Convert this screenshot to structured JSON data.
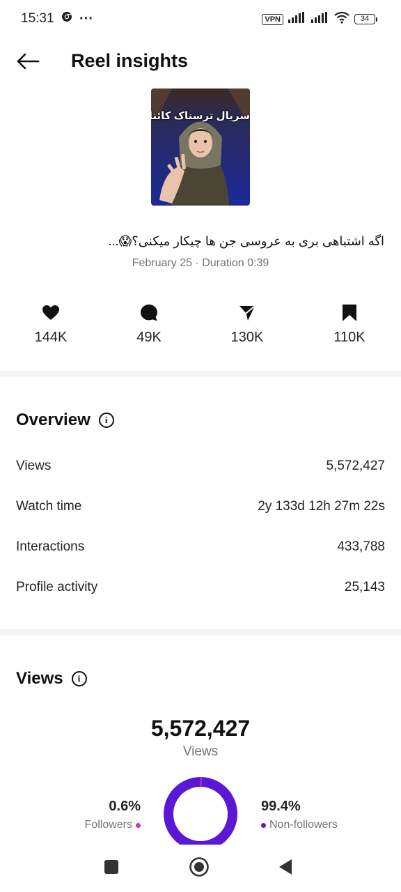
{
  "status_bar": {
    "time": "15:31",
    "more": "···",
    "vpn": "VPN",
    "battery": "34"
  },
  "header": {
    "title": "Reel insights"
  },
  "reel": {
    "thumbnail_text": "سریال ترسناک کائنات",
    "caption": "اگه اشتباهی بری به عروسی جن ها چیکار میکنی؟😱...",
    "meta": "February 25 · Duration 0:39"
  },
  "stats": {
    "likes": "144K",
    "comments": "49K",
    "shares": "130K",
    "saves": "110K"
  },
  "overview": {
    "title": "Overview",
    "rows": [
      {
        "label": "Views",
        "value": "5,572,427"
      },
      {
        "label": "Watch time",
        "value": "2y 133d 12h 27m 22s"
      },
      {
        "label": "Interactions",
        "value": "433,788"
      },
      {
        "label": "Profile activity",
        "value": "25,143"
      }
    ]
  },
  "views": {
    "title": "Views",
    "total": "5,572,427",
    "total_label": "Views",
    "followers_pct": "0.6%",
    "followers_label": "Followers",
    "non_followers_pct": "99.4%",
    "non_followers_label": "Non-followers",
    "followers_share": 0.006,
    "non_followers_share": 0.994
  },
  "colors": {
    "followers": "#c837ab",
    "non_followers": "#5a18d6",
    "divider": "#f4f5f7",
    "secondary_text": "#737373"
  },
  "icons": {
    "back": "arrow-left-icon",
    "likes": "heart-icon",
    "comments": "comment-icon",
    "shares": "send-icon",
    "saves": "bookmark-icon",
    "info": "info-icon",
    "nav_recents": "square-icon",
    "nav_home": "circle-icon",
    "nav_back": "triangle-back-icon"
  }
}
